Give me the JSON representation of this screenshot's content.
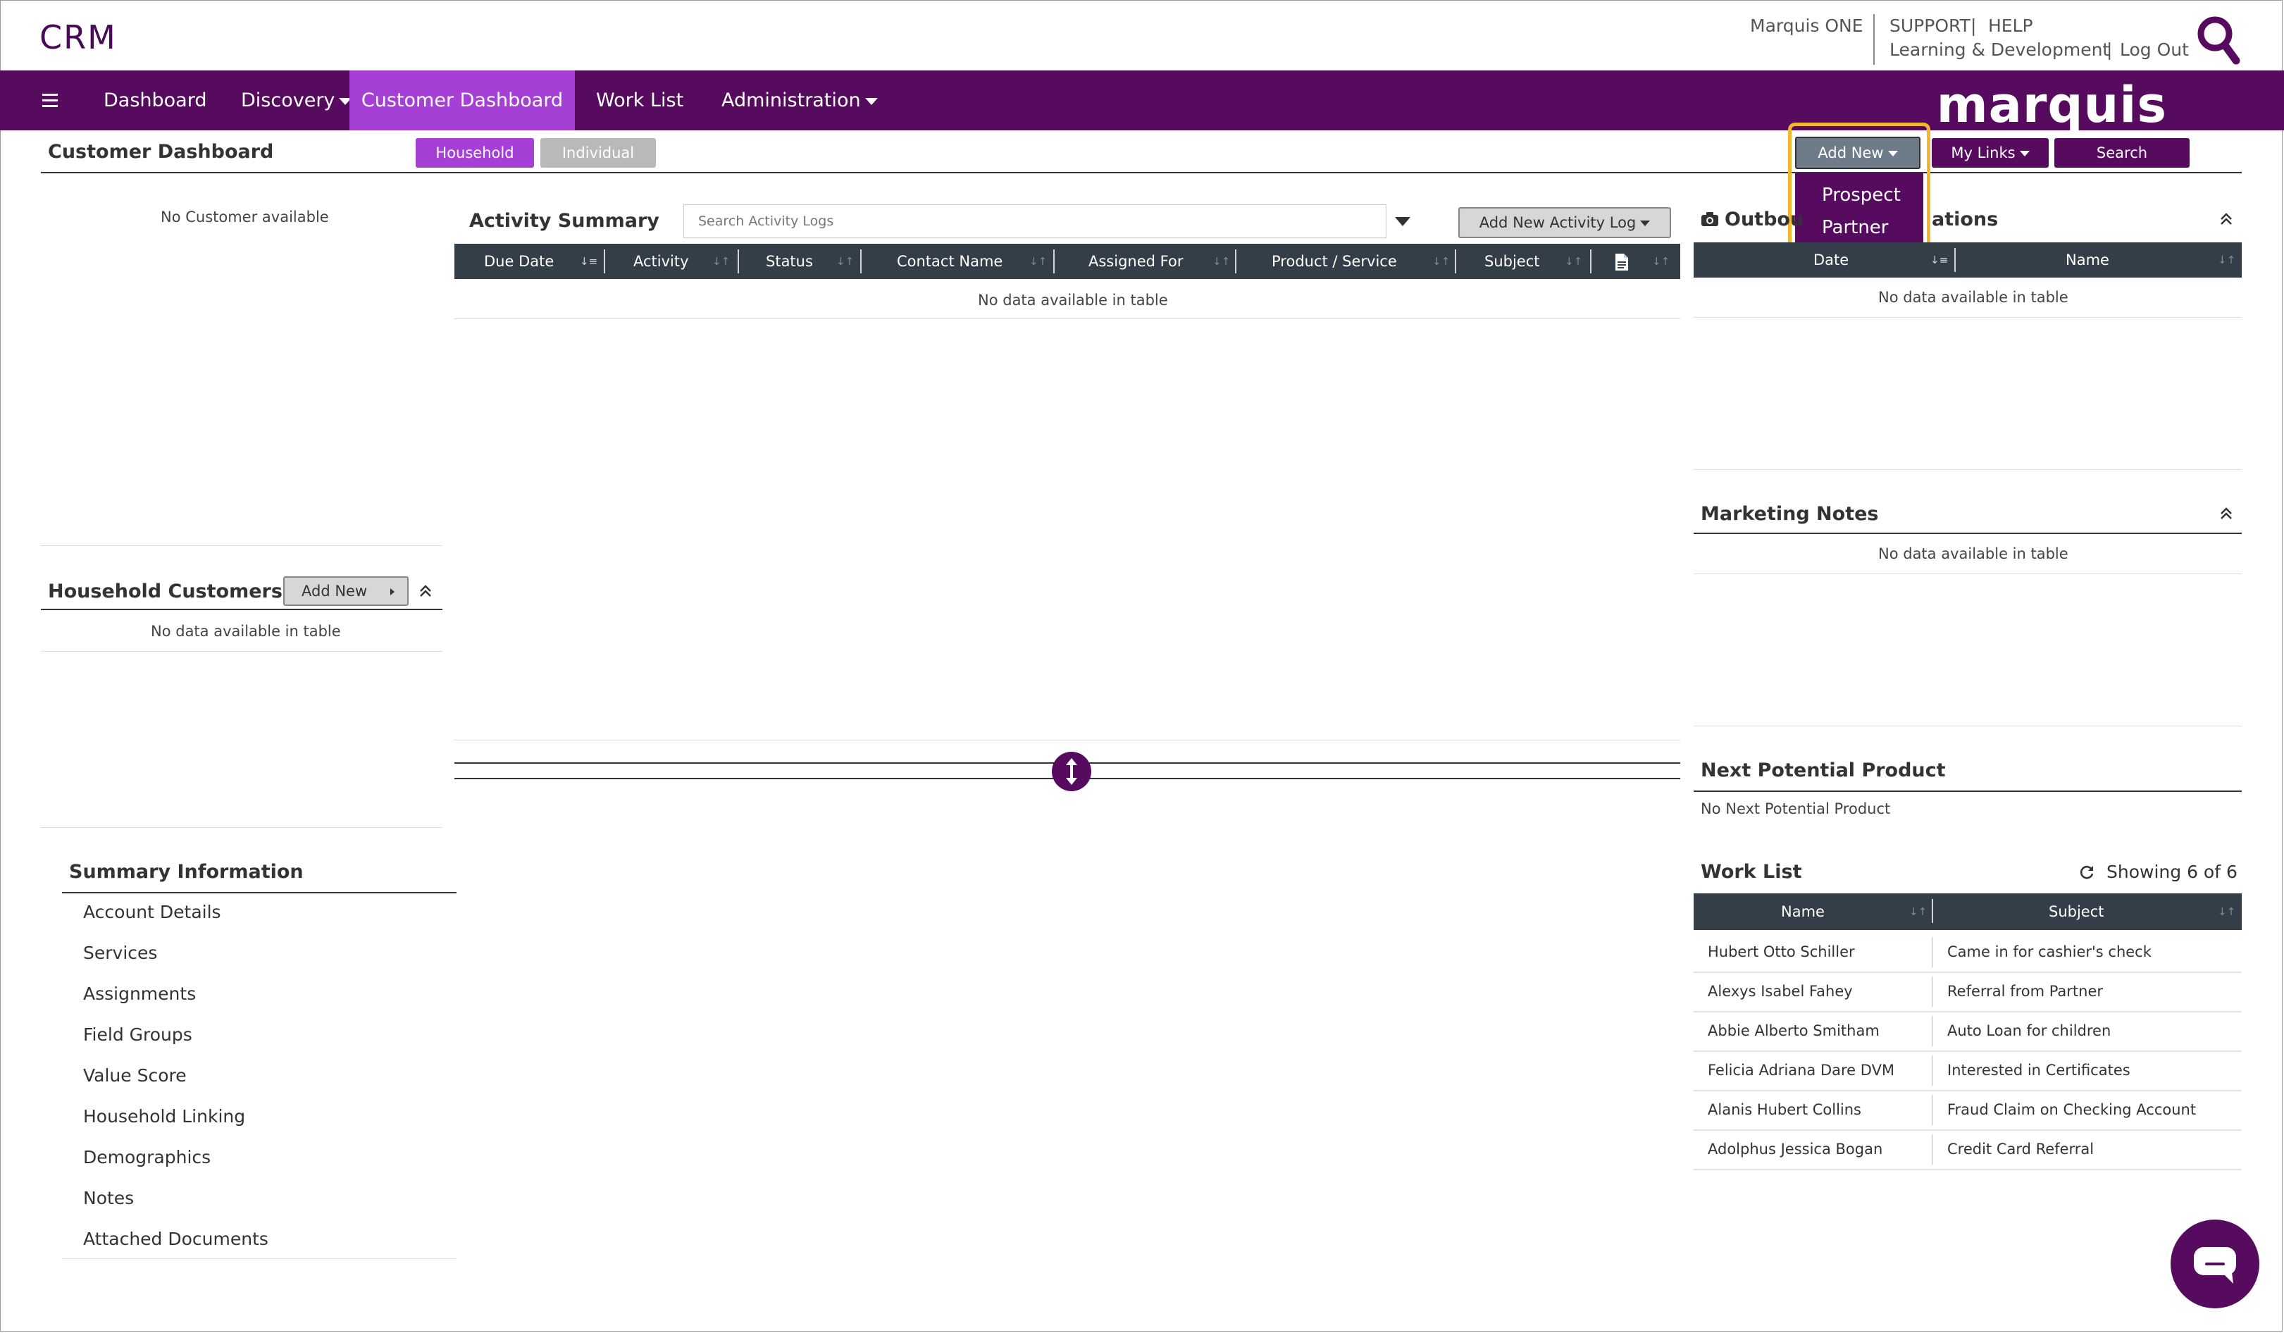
{
  "header": {
    "app_title": "CRM",
    "product": "Marquis ONE",
    "support": "SUPPORT",
    "help": "HELP",
    "learning": "Learning & Development",
    "logout": "Log Out",
    "sep": "|"
  },
  "nav": {
    "items": [
      "Dashboard",
      "Discovery",
      "Customer Dashboard",
      "Work List",
      "Administration"
    ],
    "active": "Customer Dashboard",
    "logo": "marquis"
  },
  "customer_dashboard": {
    "title": "Customer Dashboard",
    "toggle": [
      "Household",
      "Individual"
    ],
    "empty": "No Customer available"
  },
  "toolbar": {
    "add_new": "Add New",
    "add_new_menu": [
      "Prospect",
      "Partner"
    ],
    "my_links": "My Links",
    "search": "Search"
  },
  "household_customers": {
    "title": "Household Customers",
    "add_new": "Add New",
    "empty": "No data available in table"
  },
  "activity_summary": {
    "title": "Activity Summary",
    "search_placeholder": "Search Activity Logs",
    "add_log": "Add New Activity Log",
    "columns": [
      "Due Date",
      "Activity",
      "Status",
      "Contact Name",
      "Assigned For",
      "Product / Service",
      "Subject"
    ],
    "empty": "No data available in table"
  },
  "outbound": {
    "title_left": "Outbou",
    "title_right": "ations",
    "columns": [
      "Date",
      "Name"
    ],
    "empty": "No data available in table"
  },
  "marketing_notes": {
    "title": "Marketing Notes",
    "empty": "No data available in table"
  },
  "next_potential_product": {
    "title": "Next Potential Product",
    "empty": "No Next Potential Product"
  },
  "work_list": {
    "title": "Work List",
    "showing": "Showing 6 of 6",
    "columns": [
      "Name",
      "Subject"
    ],
    "rows": [
      {
        "name": "Hubert Otto Schiller",
        "subject": "Came in for cashier's check"
      },
      {
        "name": "Alexys Isabel Fahey",
        "subject": "Referral from Partner"
      },
      {
        "name": "Abbie Alberto Smitham",
        "subject": "Auto Loan for children"
      },
      {
        "name": "Felicia Adriana Dare DVM",
        "subject": "Interested in Certificates"
      },
      {
        "name": "Alanis Hubert Collins",
        "subject": "Fraud Claim on Checking Account"
      },
      {
        "name": "Adolphus Jessica Bogan",
        "subject": "Credit Card Referral"
      }
    ]
  },
  "summary_information": {
    "title": "Summary Information",
    "items": [
      "Account Details",
      "Services",
      "Assignments",
      "Field Groups",
      "Value Score",
      "Household Linking",
      "Demographics",
      "Notes",
      "Attached Documents"
    ]
  },
  "colors": {
    "brand_purple": "#560b5f",
    "active_tab": "#a53fd6",
    "highlight": "#f2b632",
    "table_header": "#343e48"
  }
}
